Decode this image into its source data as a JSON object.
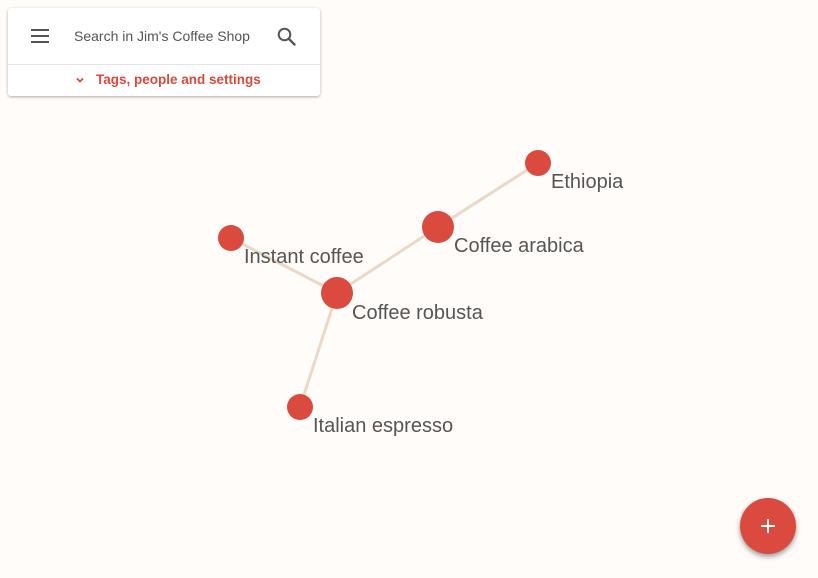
{
  "search": {
    "placeholder": "Search in Jim's Coffee Shop",
    "menu_icon": "menu-icon",
    "search_icon": "search-icon"
  },
  "tags_panel": {
    "label": "Tags, people and settings",
    "icon": "chevron-down-icon"
  },
  "graph": {
    "accent_color": "#db4a3e",
    "edge_color": "#ead8c8",
    "nodes": [
      {
        "id": "ethiopia",
        "label": "Ethiopia"
      },
      {
        "id": "coffee-arabica",
        "label": "Coffee arabica"
      },
      {
        "id": "instant-coffee",
        "label": "Instant coffee"
      },
      {
        "id": "coffee-robusta",
        "label": "Coffee robusta"
      },
      {
        "id": "italian-espresso",
        "label": "Italian espresso"
      }
    ],
    "edges": [
      [
        "ethiopia",
        "coffee-arabica"
      ],
      [
        "coffee-arabica",
        "coffee-robusta"
      ],
      [
        "instant-coffee",
        "coffee-robusta"
      ],
      [
        "coffee-robusta",
        "italian-espresso"
      ]
    ]
  },
  "fab": {
    "icon": "plus-icon",
    "color": "#db4a3e"
  }
}
